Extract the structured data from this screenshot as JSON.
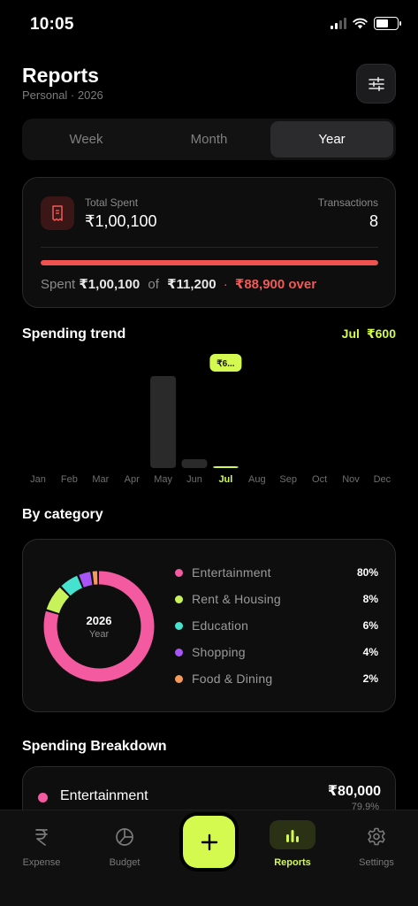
{
  "status": {
    "time": "10:05"
  },
  "header": {
    "title": "Reports",
    "subtitle": "Personal · 2026"
  },
  "segments": [
    "Week",
    "Month",
    "Year"
  ],
  "active_segment": "Year",
  "summary": {
    "total_label": "Total Spent",
    "total_value": "₹1,00,100",
    "tx_label": "Transactions",
    "tx_value": "8",
    "spent_prefix": "Spent",
    "spent_value": "₹1,00,100",
    "of_word": "of",
    "budget_value": "₹11,200",
    "separator": "·",
    "over_text": "₹88,900 over",
    "progress_fraction": 1.0
  },
  "trend": {
    "title": "Spending trend",
    "selected_month": "Jul",
    "selected_value": "₹600",
    "tooltip": "₹6..."
  },
  "chart_data": {
    "type": "bar",
    "categories": [
      "Jan",
      "Feb",
      "Mar",
      "Apr",
      "May",
      "Jun",
      "Jul",
      "Aug",
      "Sep",
      "Oct",
      "Nov",
      "Dec"
    ],
    "values": [
      0,
      0,
      0,
      0,
      98500,
      1000,
      600,
      0,
      0,
      0,
      0,
      0
    ],
    "highlighted": "Jul",
    "title": "Spending trend"
  },
  "category": {
    "title": "By category",
    "center_year": "2026",
    "center_label": "Year",
    "items": [
      {
        "name": "Entertainment",
        "pct": "80%",
        "value": 80,
        "color": "#f35aa0"
      },
      {
        "name": "Rent & Housing",
        "pct": "8%",
        "value": 8,
        "color": "#c7f25a"
      },
      {
        "name": "Education",
        "pct": "6%",
        "value": 6,
        "color": "#45e3cf"
      },
      {
        "name": "Shopping",
        "pct": "4%",
        "value": 4,
        "color": "#a855f7"
      },
      {
        "name": "Food & Dining",
        "pct": "2%",
        "value": 2,
        "color": "#f59a5a"
      }
    ]
  },
  "breakdown": {
    "title": "Spending Breakdown",
    "first": {
      "name": "Entertainment",
      "amount": "₹80,000",
      "pct": "79.9%",
      "color": "#f35aa0"
    }
  },
  "nav": {
    "items": [
      {
        "label": "Expense",
        "icon": "rupee-icon"
      },
      {
        "label": "Budget",
        "icon": "pie-icon"
      },
      {
        "label": "Reports",
        "icon": "bar-chart-icon"
      },
      {
        "label": "Settings",
        "icon": "gear-icon"
      }
    ],
    "active": "Reports",
    "fab_icon": "plus-icon"
  },
  "colors": {
    "accent": "#d4fa50",
    "danger": "#f0524f"
  }
}
